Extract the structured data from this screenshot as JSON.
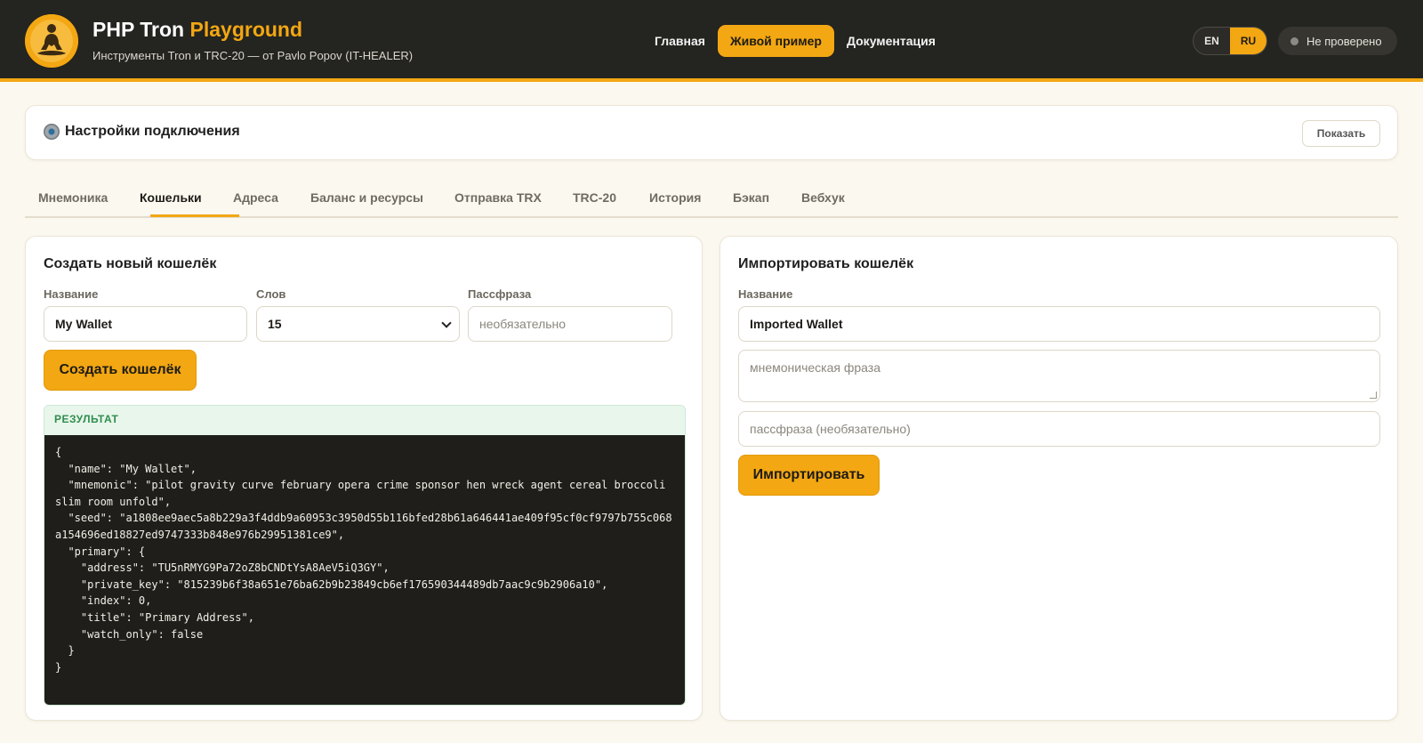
{
  "header": {
    "brand_main": "PHP Tron",
    "brand_accent": "Playground",
    "subtitle": "Инструменты Tron и TRC-20 — от Pavlo Popov (IT-HEALER)",
    "nav": [
      "Главная",
      "Живой пример",
      "Документация"
    ],
    "active_nav": "Живой пример",
    "languages": [
      "EN",
      "RU"
    ],
    "active_language": "RU",
    "status": "Не проверено",
    "colors": {
      "background": "#242420",
      "accent": "#f3a712"
    },
    "logo_icon": "meditating-person-logo"
  },
  "settings": {
    "icon": "gear-icon",
    "title": "Настройки подключения",
    "toggle_label": "Показать"
  },
  "tabs": {
    "items": [
      "Мнемоника",
      "Кошельки",
      "Адреса",
      "Баланс и ресурсы",
      "Отправка TRX",
      "TRC-20",
      "История",
      "Бэкап",
      "Вебхук"
    ],
    "active": "Кошельки"
  },
  "create": {
    "title": "Создать новый кошелёк",
    "name_label": "Название",
    "name_value": "My Wallet",
    "words_label": "Слов",
    "words_value": "15",
    "passphrase_label": "Пассфраза",
    "passphrase_placeholder": "необязательно",
    "button": "Создать кошелёк",
    "result_label": "РЕЗУЛЬТАТ",
    "result_json": "{\n  \"name\": \"My Wallet\",\n  \"mnemonic\": \"pilot gravity curve february opera crime sponsor hen wreck agent cereal broccoli slim room unfold\",\n  \"seed\": \"a1808ee9aec5a8b229a3f4ddb9a60953c3950d55b116bfed28b61a646441ae409f95cf0cf9797b755c068a154696ed18827ed9747333b848e976b29951381ce9\",\n  \"primary\": {\n    \"address\": \"TU5nRMYG9Pa72oZ8bCNDtYsA8AeV5iQ3GY\",\n    \"private_key\": \"815239b6f38a651e76ba62b9b23849cb6ef176590344489db7aac9c9b2906a10\",\n    \"index\": 0,\n    \"title\": \"Primary Address\",\n    \"watch_only\": false\n  }\n}"
  },
  "import": {
    "title": "Импортировать кошелёк",
    "name_label": "Название",
    "name_value": "Imported Wallet",
    "mnemonic_placeholder": "мнемоническая фраза",
    "passphrase_placeholder": "пассфраза (необязательно)",
    "button": "Импортировать"
  }
}
